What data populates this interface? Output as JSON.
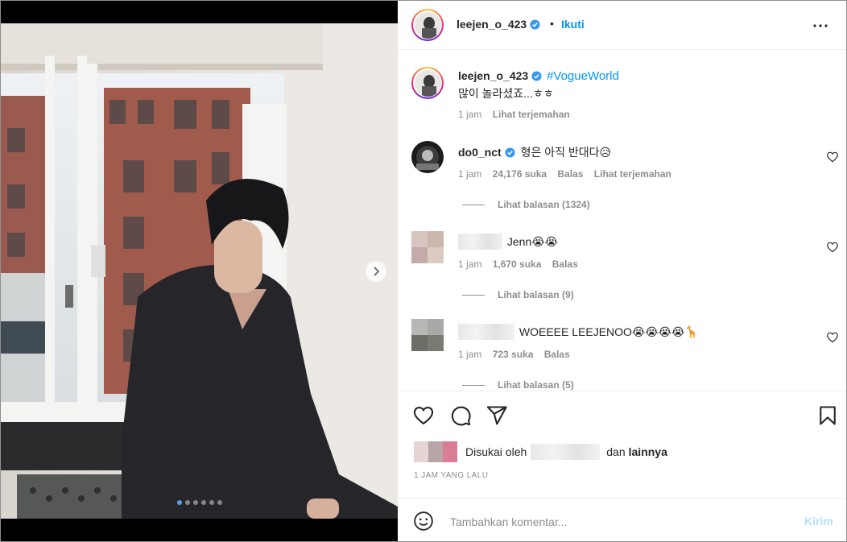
{
  "post": {
    "username": "leejen_o_423",
    "separator": "•",
    "follow_label": "Ikuti",
    "caption_tag": "#VogueWorld",
    "caption_text": "많이 놀라셨죠...ㅎㅎ",
    "caption_time": "1 jam",
    "caption_translate": "Lihat terjemahan",
    "carousel_total": 6,
    "carousel_active": 1
  },
  "comments": [
    {
      "username": "do0_nct",
      "text": "형은 아직 반대다😥",
      "time": "1 jam",
      "likes": "24,176 suka",
      "reply": "Balas",
      "translate": "Lihat terjemahan",
      "view_replies": "Lihat balasan (1324)"
    },
    {
      "text": "Jenn😭😭",
      "time": "1 jam",
      "likes": "1,670 suka",
      "reply": "Balas",
      "view_replies": "Lihat balasan (9)"
    },
    {
      "text": "WOEEEE LEEJENOO😭😭😭😭🦒",
      "time": "1 jam",
      "likes": "723 suka",
      "reply": "Balas",
      "view_replies": "Lihat balasan (5)"
    }
  ],
  "likes_bar": {
    "prefix": "Disukai oleh",
    "middle": "dan",
    "suffix": "lainnya"
  },
  "time_ago": "1 JAM YANG LALU",
  "composer": {
    "placeholder": "Tambahkan komentar...",
    "post_label": "Kirim"
  },
  "icons": [
    "more-icon",
    "verified-badge-icon",
    "heart-icon",
    "comment-icon",
    "share-icon",
    "bookmark-icon",
    "emoji-icon",
    "chevron-right-icon"
  ],
  "colors": {
    "link_blue": "#0095f6",
    "muted": "#8e8e8e",
    "text": "#262626",
    "post_disabled": "#b2dffc"
  }
}
